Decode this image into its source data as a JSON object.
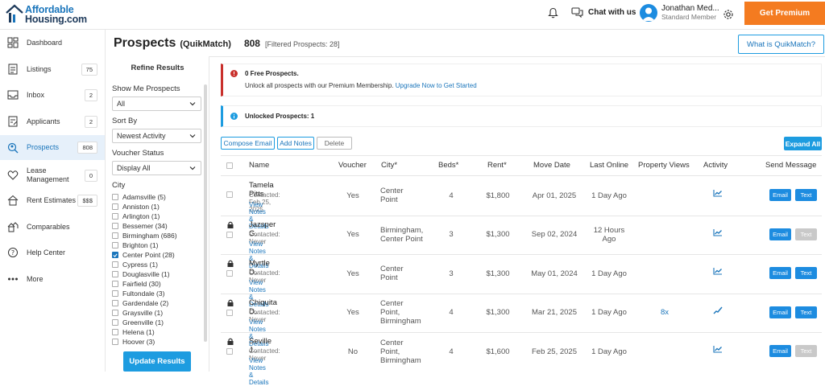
{
  "header": {
    "logo_line1": "Affordable",
    "logo_line2": "Housing.com",
    "chat_label": "Chat with us",
    "user_name": "Jonathan Med...",
    "user_role": "Standard Member",
    "premium_label": "Get Premium"
  },
  "sidebar": {
    "items": [
      {
        "label": "Dashboard",
        "count": "",
        "icon": "dashboard-icon"
      },
      {
        "label": "Listings",
        "count": "75",
        "icon": "listings-icon"
      },
      {
        "label": "Inbox",
        "count": "2",
        "icon": "inbox-icon"
      },
      {
        "label": "Applicants",
        "count": "2",
        "icon": "applicants-icon"
      },
      {
        "label": "Prospects",
        "count": "808",
        "icon": "prospects-icon"
      },
      {
        "label": "Lease Management",
        "count": "0",
        "icon": "lease-icon"
      },
      {
        "label": "Rent Estimates",
        "count": "$$$",
        "icon": "rent-estimates-icon"
      },
      {
        "label": "Comparables",
        "count": "",
        "icon": "comparables-icon"
      },
      {
        "label": "Help Center",
        "count": "",
        "icon": "help-icon"
      },
      {
        "label": "More",
        "count": "",
        "icon": "more-icon"
      }
    ]
  },
  "page": {
    "title": "Prospects",
    "subtitle": "(QuikMatch)",
    "count": "808",
    "filtered": "[Filtered Prospects: 28]",
    "whatis_label": "What is QuikMatch?"
  },
  "refine": {
    "title": "Refine Results",
    "show_label": "Show Me Prospects",
    "show_value": "All",
    "sort_label": "Sort By",
    "sort_value": "Newest Activity",
    "voucher_label": "Voucher Status",
    "voucher_value": "Display All",
    "city_label": "City",
    "cities": [
      {
        "label": "Adamsville (5)",
        "checked": false
      },
      {
        "label": "Anniston (1)",
        "checked": false
      },
      {
        "label": "Arlington (1)",
        "checked": false
      },
      {
        "label": "Bessemer (34)",
        "checked": false
      },
      {
        "label": "Birmingham (686)",
        "checked": false
      },
      {
        "label": "Brighton (1)",
        "checked": false
      },
      {
        "label": "Center Point (28)",
        "checked": true
      },
      {
        "label": "Cypress (1)",
        "checked": false
      },
      {
        "label": "Douglasville (1)",
        "checked": false
      },
      {
        "label": "Fairfield (30)",
        "checked": false
      },
      {
        "label": "Fultondale (3)",
        "checked": false
      },
      {
        "label": "Gardendale (2)",
        "checked": false
      },
      {
        "label": "Graysville (1)",
        "checked": false
      },
      {
        "label": "Greenville (1)",
        "checked": false
      },
      {
        "label": "Helena (1)",
        "checked": false
      },
      {
        "label": "Hoover (3)",
        "checked": false
      }
    ],
    "update_label": "Update Results"
  },
  "alerts": {
    "free_title": "0 Free Prospects.",
    "free_text": "Unlock all prospects with our Premium Membership.",
    "free_link": "Upgrade Now to Get Started",
    "unlocked_title": "Unlocked Prospects: 1"
  },
  "actions": {
    "compose": "Compose Email",
    "add_notes": "Add Notes",
    "delete": "Delete",
    "expand": "Expand All"
  },
  "table": {
    "headers": {
      "name": "Name",
      "voucher": "Voucher",
      "city": "City*",
      "beds": "Beds*",
      "rent": "Rent*",
      "move": "Move Date",
      "online": "Last Online",
      "views": "Property Views",
      "activity": "Activity",
      "send": "Send Message"
    },
    "rows": [
      {
        "name": "Tamela Pitts",
        "contacted": "Contacted: Feb 25, 2025",
        "notes": "View Notes & Details",
        "voucher": "Yes",
        "city": "Center\nPoint",
        "beds": "4",
        "rent": "$1,800",
        "move": "Apr 01, 2025",
        "online": "1 Day Ago",
        "views": "",
        "locked": false,
        "text_enabled": true
      },
      {
        "name": "Jazsper G...",
        "contacted": "Contacted: Never",
        "notes": "View Notes & Details",
        "voucher": "Yes",
        "city": "Birmingham,\nCenter Point",
        "beds": "3",
        "rent": "$1,300",
        "move": "Sep 02, 2024",
        "online": "12 Hours\nAgo",
        "views": "",
        "locked": true,
        "text_enabled": false
      },
      {
        "name": "Myrtle D...",
        "contacted": "Contacted: Never",
        "notes": "View Notes & Details",
        "voucher": "Yes",
        "city": "Center\nPoint",
        "beds": "3",
        "rent": "$1,300",
        "move": "May 01, 2024",
        "online": "1 Day Ago",
        "views": "",
        "locked": true,
        "text_enabled": true
      },
      {
        "name": "Chiquita D...",
        "contacted": "Contacted: Never",
        "notes": "View Notes & Details",
        "voucher": "Yes",
        "city": "Center\nPoint,\nBirmingham",
        "beds": "4",
        "rent": "$1,300",
        "move": "Mar 21, 2025",
        "online": "1 Day Ago",
        "views": "8x",
        "locked": true,
        "text_enabled": true
      },
      {
        "name": "Seville J...",
        "contacted": "Contacted: Never",
        "notes": "View Notes & Details",
        "voucher": "No",
        "city": "Center\nPoint,\nBirmingham",
        "beds": "4",
        "rent": "$1,600",
        "move": "Feb 25, 2025",
        "online": "1 Day Ago",
        "views": "",
        "locked": true,
        "text_enabled": false
      }
    ],
    "email_label": "Email",
    "text_label": "Text"
  },
  "colors": {
    "accent": "#1d9ce0",
    "premium": "#f47b20",
    "alert": "#c9302c"
  }
}
